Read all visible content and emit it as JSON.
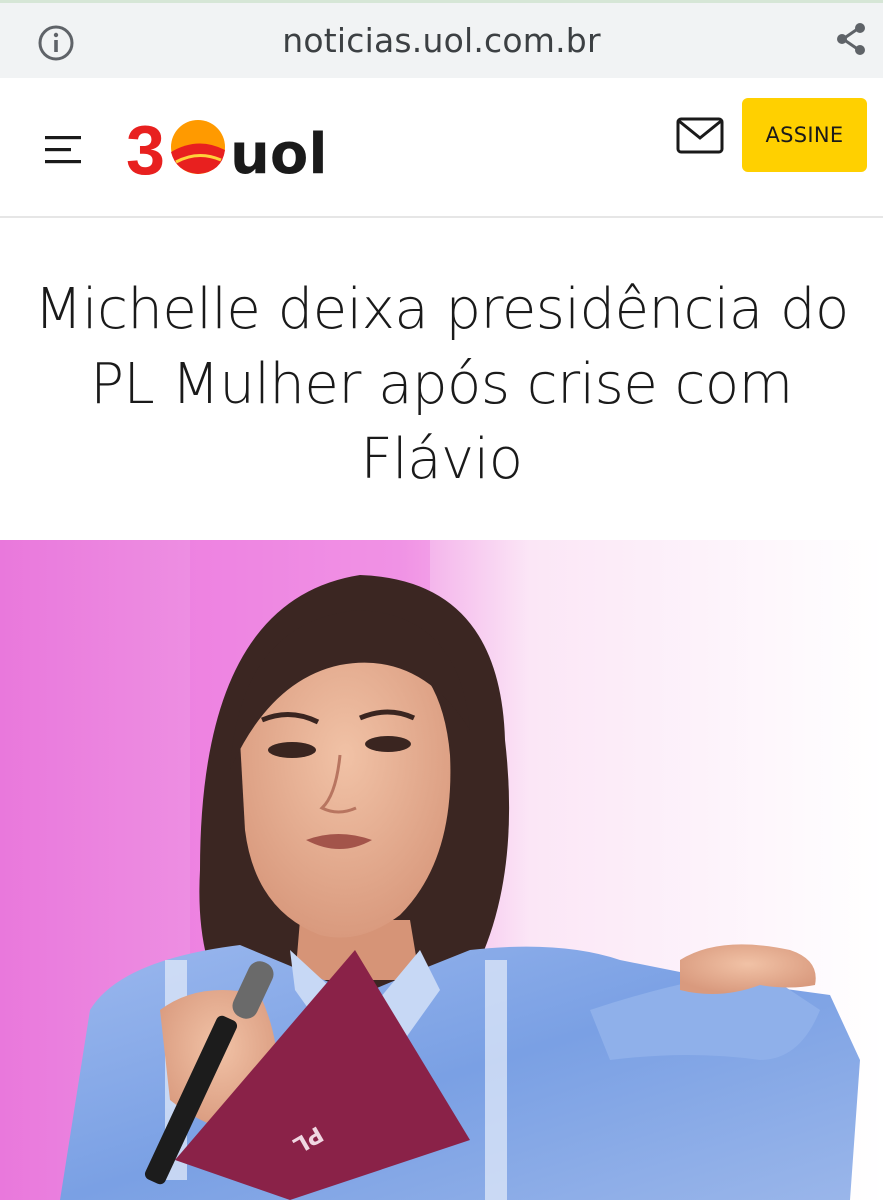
{
  "browser": {
    "url": "noticias.uol.com.br",
    "icons": {
      "info": "info-icon",
      "share": "share-icon"
    }
  },
  "header": {
    "logo_number": "30",
    "logo_text": "uol",
    "subscribe_label": "ASSINE",
    "icons": {
      "menu": "menu-icon",
      "mail": "mail-icon"
    },
    "colors": {
      "accent": "#ffd000",
      "logo_red": "#e8201f",
      "logo_orange": "#ff8a00"
    }
  },
  "article": {
    "headline": "Michelle deixa presidência do PL Mulher após crise com Flávio",
    "card_text": "PL"
  }
}
